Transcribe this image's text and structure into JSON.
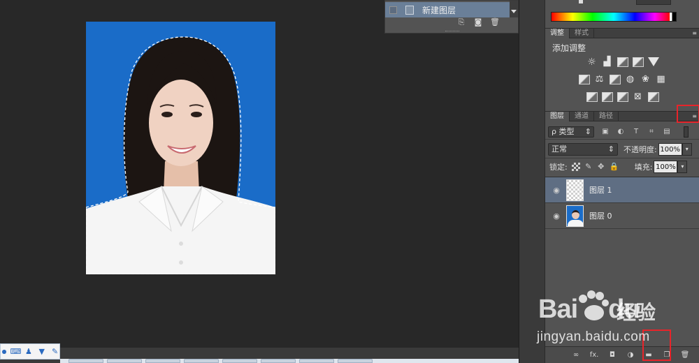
{
  "history": {
    "item_label": "新建图层",
    "item_icon": "document-icon",
    "tools": [
      "new-document-from-state-icon",
      "camera-icon",
      "trash-icon"
    ]
  },
  "color_panel": {
    "spectrum_icon": "color-spectrum"
  },
  "adjustments": {
    "tabs": [
      "调整",
      "样式"
    ],
    "active_tab": "调整",
    "title": "添加调整",
    "icons_row1": [
      "brightness-contrast-icon",
      "levels-icon",
      "curves-icon",
      "exposure-icon",
      "vibrance-icon"
    ],
    "icons_row2": [
      "hue-saturation-icon",
      "color-balance-icon",
      "black-white-icon",
      "photo-filter-icon",
      "channel-mixer-icon",
      "color-lookup-icon"
    ],
    "icons_row3": [
      "invert-icon",
      "posterize-icon",
      "threshold-icon",
      "selective-color-icon",
      "gradient-map-icon"
    ]
  },
  "layers": {
    "tabs": [
      "图层",
      "通道",
      "路径"
    ],
    "active_tab": "图层",
    "filter_kind": "ρ 类型",
    "blend_mode": "正常",
    "opacity_label": "不透明度:",
    "opacity_value": "100%",
    "lock_label": "锁定:",
    "fill_label": "填充:",
    "fill_value": "100%",
    "items": [
      {
        "name": "图层 1",
        "selected": true,
        "visible": true,
        "thumb": "transparent"
      },
      {
        "name": "图层 0",
        "selected": false,
        "visible": true,
        "thumb": "photo"
      }
    ],
    "footer_icons": [
      "link-icon",
      "fx-icon",
      "mask-icon",
      "adjustment-layer-icon",
      "group-folder-icon",
      "new-layer-icon",
      "delete-layer-icon"
    ],
    "footer_fx_text": "fx."
  },
  "watermark": {
    "brand": "Bai",
    "brand_suffix": "du",
    "chinese": "经验",
    "url": "jingyan.baidu.com"
  },
  "colors": {
    "photo_background": "#1a6cc8",
    "highlight_red": "#e8242a",
    "selected_layer": "#5f6e83",
    "panel_gray": "#535353"
  }
}
